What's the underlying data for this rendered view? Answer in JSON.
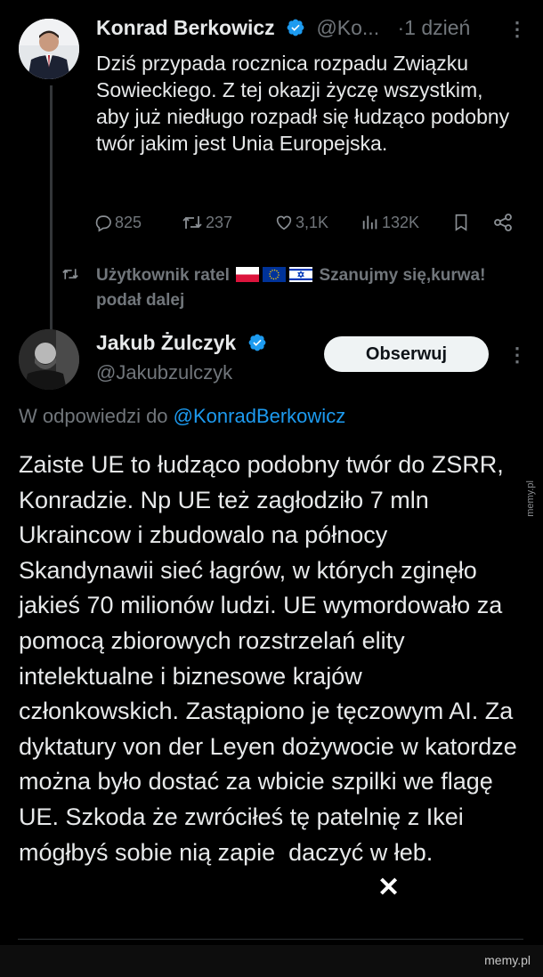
{
  "tweet1": {
    "name": "Konrad Berkowicz",
    "handle": "@Ko...",
    "time": "·1 dzień",
    "text": "Dziś przypada rocznica rozpadu Związku Sowieckiego. Z tej okazji życzę wszystkim, aby już niedługo rozpadł się łudząco podobny twór jakim jest Unia Europejska.",
    "stats": {
      "replies": "825",
      "reposts": "237",
      "likes": "3,1K",
      "views": "132K"
    }
  },
  "repost": {
    "text_before": "Użytkownik ratel",
    "text_after": "Szanujmy się,kurwa!",
    "text_line2": "podał dalej"
  },
  "tweet2": {
    "name": "Jakub Żulczyk",
    "handle": "@Jakubzulczyk",
    "follow_label": "Obserwuj",
    "reply_prefix": "W odpowiedzi do",
    "reply_mention": "@KonradBerkowicz",
    "text": "Zaiste UE to łudząco podobny twór do ZSRR, Konradzie. Np UE też zagłodziło 7 mln Ukraincow i zbudowalo na północy Skandynawii sieć łagrów, w których zginęło jakieś 70 milionów ludzi. UE wymordowało za pomocą zbiorowych rozstrzelań elity intelektualne i biznesowe krajów członkowskich. Zastąpiono je tęczowym AI. Za dyktatury von der Leyen dożywocie w katordze można było dostać za wbicie szpilki we flagę UE. Szkoda że zwróciłeś tę patelnię z Ikei mógłbyś sobie nią zapie  daczyć w łeb."
  },
  "watermark": {
    "side": "memy.pl",
    "footer": "memy.pl"
  },
  "colors": {
    "background": "#000000",
    "text": "#e7e9ea",
    "muted": "#71767b",
    "link": "#1d9bf0",
    "verified": "#1d9bf0"
  },
  "icons": [
    "verified-badge-icon",
    "more-icon",
    "reply-icon",
    "repost-icon",
    "like-icon",
    "views-icon",
    "bookmark-icon",
    "share-icon",
    "poland-flag-icon",
    "eu-flag-icon",
    "israel-flag-icon"
  ]
}
